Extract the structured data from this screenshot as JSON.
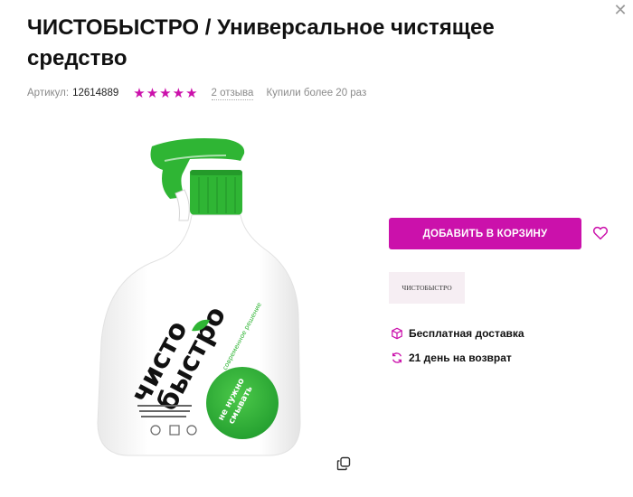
{
  "product": {
    "title": "ЧИСТОБЫСТРО / Универсальное чистящее средство",
    "sku_label": "Артикул:",
    "sku_value": "12614889",
    "rating_stars": 5,
    "reviews_text": "2 отзыва",
    "bought_text": "Купили более 20 раз"
  },
  "image": {
    "brand_line1": "чисто",
    "brand_line2": "быстро",
    "side_text": "современное решение",
    "circle_line1": "не нужно",
    "circle_line2": "смывать"
  },
  "actions": {
    "add_to_cart_label": "ДОБАВИТЬ В КОРЗИНУ",
    "brand_badge": "ЧИСТОБЫСТРО"
  },
  "perks": {
    "delivery": "Бесплатная доставка",
    "returns": "21 день на возврат"
  },
  "colors": {
    "accent": "#cb11ab",
    "bottle_green": "#2fb534",
    "star": "#cb11ab"
  },
  "icons": {
    "close": "close-icon",
    "wishlist": "heart-icon",
    "delivery": "box-icon",
    "returns": "refresh-icon",
    "gallery": "copy-icon",
    "rating": "star-icon"
  }
}
